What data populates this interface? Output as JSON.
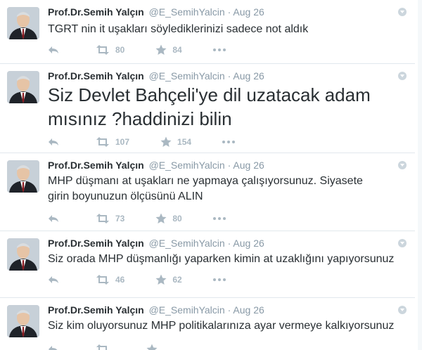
{
  "tweets": [
    {
      "name": "Prof.Dr.Semih Yalçın",
      "handle": "@E_SemihYalcin",
      "separator": "·",
      "date": "Aug 26",
      "text": "TGRT nin it uşakları söylediklerinizi sadece not aldık",
      "retweets": "80",
      "favorites": "84"
    },
    {
      "name": "Prof.Dr.Semih Yalçın",
      "handle": "@E_SemihYalcin",
      "separator": "·",
      "date": "Aug 26",
      "text": "Siz Devlet Bahçeli'ye dil uzatacak adam mısınız ?haddinizi bilin",
      "retweets": "107",
      "favorites": "154"
    },
    {
      "name": "Prof.Dr.Semih Yalçın",
      "handle": "@E_SemihYalcin",
      "separator": "·",
      "date": "Aug 26",
      "text": "MHP düşmanı at uşakları ne yapmaya çalışıyorsunuz. Siyasete girin boyunuzun ölçüsünü ALIN",
      "retweets": "73",
      "favorites": "80"
    },
    {
      "name": "Prof.Dr.Semih Yalçın",
      "handle": "@E_SemihYalcin",
      "separator": "·",
      "date": "Aug 26",
      "text": "Siz orada MHP düşmanlığı yaparken kimin at uzaklığını yapıyorsunuz",
      "retweets": "46",
      "favorites": "62"
    },
    {
      "name": "Prof.Dr.Semih Yalçın",
      "handle": "@E_SemihYalcin",
      "separator": "·",
      "date": "Aug 26",
      "text": "Siz kim oluyorsunuz MHP politikalarınıza ayar vermeye kalkıyorsunuz",
      "retweets": "",
      "favorites": ""
    }
  ],
  "icons": {
    "reply": "reply-icon",
    "retweet": "retweet-icon",
    "favorite": "star-icon",
    "more": "more-icon",
    "caret": "caret-down-icon"
  },
  "colors": {
    "name": "#292f33",
    "muted": "#8899a6",
    "action": "#aab8c2",
    "divider": "#e1e8ed"
  }
}
